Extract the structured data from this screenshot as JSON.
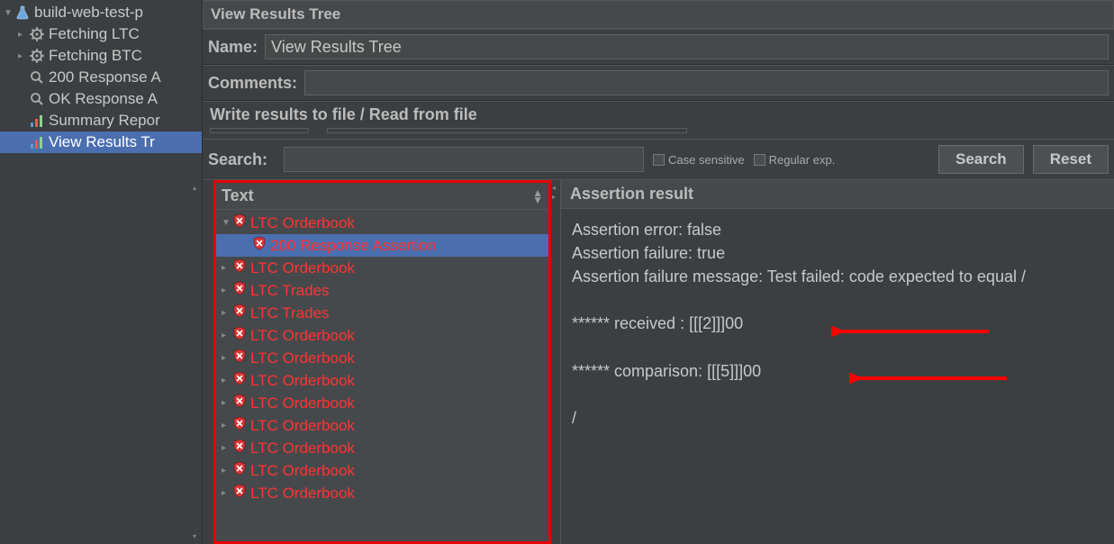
{
  "sidebar": {
    "root": "build-web-test-p",
    "items": [
      {
        "label": "Fetching LTC",
        "icon": "gear"
      },
      {
        "label": "Fetching BTC",
        "icon": "gear"
      },
      {
        "label": "200 Response A",
        "icon": "lens"
      },
      {
        "label": "OK  Response A",
        "icon": "lens"
      },
      {
        "label": "Summary Repor",
        "icon": "chart"
      },
      {
        "label": "View Results Tr",
        "icon": "chart",
        "selected": true
      }
    ]
  },
  "panel": {
    "title": "View Results Tree",
    "name_label": "Name:",
    "name_value": "View Results Tree",
    "comments_label": "Comments:",
    "fieldset_title": "Write results to file / Read from file"
  },
  "search": {
    "label": "Search:",
    "value": "",
    "case_sensitive_label": "Case sensitive",
    "regex_label": "Regular exp.",
    "search_btn": "Search",
    "reset_btn": "Reset"
  },
  "results": {
    "dropdown_label": "Text",
    "items": [
      {
        "label": "LTC Orderbook",
        "level": 1,
        "expanded": true
      },
      {
        "label": "200 Response Assertion",
        "level": 2,
        "selected": true
      },
      {
        "label": "LTC Orderbook",
        "level": 1
      },
      {
        "label": "LTC Trades",
        "level": 1
      },
      {
        "label": "LTC Trades",
        "level": 1
      },
      {
        "label": "LTC Orderbook",
        "level": 1
      },
      {
        "label": "LTC Orderbook",
        "level": 1
      },
      {
        "label": "LTC Orderbook",
        "level": 1
      },
      {
        "label": "LTC Orderbook",
        "level": 1
      },
      {
        "label": "LTC Orderbook",
        "level": 1
      },
      {
        "label": "LTC Orderbook",
        "level": 1
      },
      {
        "label": "LTC Orderbook",
        "level": 1
      },
      {
        "label": "LTC Orderbook",
        "level": 1
      }
    ]
  },
  "assertion": {
    "header": "Assertion result",
    "lines": [
      "Assertion error: false",
      "Assertion failure: true",
      "Assertion failure message: Test failed: code expected to equal /",
      "",
      "****** received  : [[[2]]]00",
      "",
      "****** comparison: [[[5]]]00",
      "",
      "/"
    ]
  }
}
